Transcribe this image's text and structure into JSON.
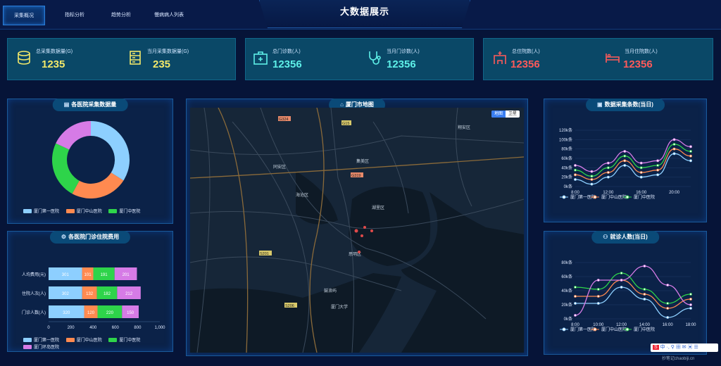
{
  "nav": {
    "tabs": [
      {
        "label": "采集概况",
        "active": true
      },
      {
        "label": "指标分析",
        "active": false
      },
      {
        "label": "趋势分析",
        "active": false
      },
      {
        "label": "慢病病人列表",
        "active": false
      }
    ],
    "title": "大数据展示"
  },
  "stats": [
    {
      "label": "总采集数据量(G)",
      "value": "1235",
      "color": "#f3e96a",
      "icon": "database-icon"
    },
    {
      "label": "当月采集数据量(G)",
      "value": "235",
      "color": "#f3e96a",
      "icon": "server-icon"
    },
    {
      "label": "总门诊数(人)",
      "value": "12356",
      "color": "#5ef0e8",
      "icon": "medical-kit-icon"
    },
    {
      "label": "当月门诊数(人)",
      "value": "12356",
      "color": "#5ef0e8",
      "icon": "stethoscope-icon"
    },
    {
      "label": "总住院数(人)",
      "value": "12356",
      "color": "#ff5a5a",
      "icon": "hospital-icon"
    },
    {
      "label": "当月住院数(人)",
      "value": "12356",
      "color": "#ff5a5a",
      "icon": "bed-icon"
    }
  ],
  "panels": {
    "donut_title": "各医院采集数据量",
    "bar_title": "各医院门诊住院费用",
    "map_title": "厦门市地图",
    "line1_title": "数据采集条数(当日)",
    "line2_title": "就诊人数(当日)"
  },
  "hospitals": [
    "厦门第一医院",
    "厦门中山医院",
    "厦门中医院",
    "厦门环岛医院"
  ],
  "colors": {
    "h1": "#8dcfff",
    "h2": "#ff8a50",
    "h3": "#2ed44a",
    "h4": "#d67be6"
  },
  "map": {
    "toggle": [
      "地图",
      "卫星"
    ],
    "labels": [
      "同安区",
      "集美区",
      "湖里区",
      "思明区",
      "海沧区",
      "翔安区",
      "厦门大学",
      "鼓浪屿",
      "G15",
      "G324",
      "G319",
      "S201",
      "S206"
    ]
  },
  "chart_data": [
    {
      "type": "pie",
      "title": "各医院采集数据量",
      "categories": [
        "厦门第一医院",
        "厦门中山医院",
        "厦门中医院",
        "厦门环岛医院"
      ],
      "values": [
        34,
        24,
        24,
        18
      ],
      "legend": "bottom"
    },
    {
      "type": "bar",
      "title": "各医院门诊住院费用",
      "orientation": "horizontal",
      "stacked": true,
      "categories": [
        "人均费用(元)",
        "住院人次(人)",
        "门诊人数(人)"
      ],
      "series": [
        {
          "name": "厦门第一医院",
          "values": [
            301,
            302,
            320
          ]
        },
        {
          "name": "厦门中山医院",
          "values": [
            101,
            132,
            120
          ]
        },
        {
          "name": "厦门中医院",
          "values": [
            191,
            182,
            220
          ]
        },
        {
          "name": "厦门环岛医院",
          "values": [
            201,
            212,
            150
          ]
        }
      ],
      "xticks": [
        "0",
        "200",
        "400",
        "600",
        "800",
        "1,000"
      ],
      "xlim": [
        0,
        1000
      ],
      "legend": "bottom"
    },
    {
      "type": "line",
      "title": "数据采集条数(当日)",
      "x": [
        "8:00",
        "",
        "12:00",
        "",
        "16:00",
        "",
        "20:00",
        ""
      ],
      "xticks": [
        "8:00",
        "12:00",
        "16:00",
        "20:00"
      ],
      "yticks": [
        "0k条",
        "20k条",
        "40k条",
        "60k条",
        "80k条",
        "100k条",
        "120k条"
      ],
      "ylim": [
        0,
        120
      ],
      "series": [
        {
          "name": "厦门第一医院",
          "values": [
            15,
            5,
            20,
            45,
            20,
            25,
            70,
            55
          ]
        },
        {
          "name": "厦门中山医院",
          "values": [
            25,
            15,
            30,
            55,
            30,
            35,
            80,
            65
          ]
        },
        {
          "name": "厦门中医院",
          "values": [
            35,
            22,
            40,
            65,
            40,
            45,
            90,
            75
          ]
        },
        {
          "name": "厦门环岛医院",
          "values": [
            45,
            32,
            50,
            75,
            50,
            55,
            100,
            85
          ]
        }
      ],
      "legend": "bottom"
    },
    {
      "type": "line",
      "title": "就诊人数(当日)",
      "x": [
        "8:00",
        "10:00",
        "12:00",
        "14:00",
        "16:00",
        "18:00"
      ],
      "yticks": [
        "0k条",
        "20k条",
        "40k条",
        "60k条",
        "80k条"
      ],
      "ylim": [
        0,
        80
      ],
      "series": [
        {
          "name": "厦门第一医院",
          "values": [
            22,
            22,
            45,
            28,
            2,
            15
          ]
        },
        {
          "name": "厦门中山医院",
          "values": [
            32,
            32,
            55,
            35,
            15,
            28
          ]
        },
        {
          "name": "厦门中医院",
          "values": [
            45,
            42,
            65,
            42,
            22,
            35
          ]
        },
        {
          "name": "厦门环岛医院",
          "values": [
            5,
            55,
            55,
            75,
            48,
            20
          ]
        }
      ],
      "legend": "bottom"
    }
  ],
  "watermark": "抄笔记chaobiji.cn"
}
